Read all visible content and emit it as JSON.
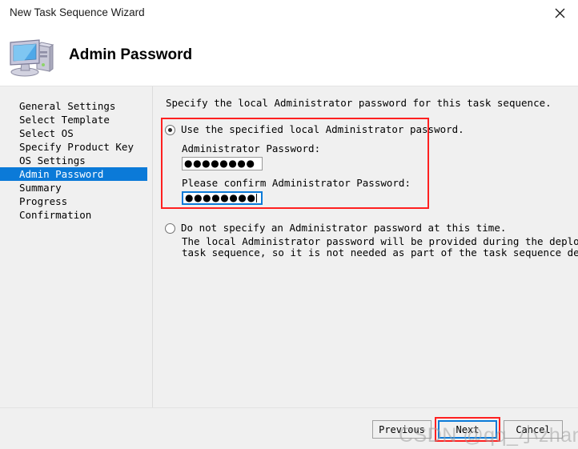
{
  "window": {
    "title": "New Task Sequence Wizard",
    "close_icon": "close-icon"
  },
  "header": {
    "title": "Admin Password",
    "icon": "computer-icon"
  },
  "sidebar": {
    "items": [
      {
        "label": "General Settings",
        "selected": false
      },
      {
        "label": "Select Template",
        "selected": false
      },
      {
        "label": "Select OS",
        "selected": false
      },
      {
        "label": "Specify Product Key",
        "selected": false
      },
      {
        "label": "OS Settings",
        "selected": false
      },
      {
        "label": "Admin Password",
        "selected": true
      },
      {
        "label": "Summary",
        "selected": false
      },
      {
        "label": "Progress",
        "selected": false
      },
      {
        "label": "Confirmation",
        "selected": false
      }
    ]
  },
  "main": {
    "intro": "Specify the local Administrator password for this task sequence.",
    "option_use_specified": {
      "label": "Use the specified local Administrator password.",
      "selected": true,
      "password_label": "Administrator Password:",
      "password_value": "●●●●●●●●",
      "confirm_label": "Please confirm Administrator Password:",
      "confirm_value": "●●●●●●●●"
    },
    "option_do_not_specify": {
      "label": "Do not specify an Administrator password at this time.",
      "selected": false,
      "description_line1": "The local Administrator password will be provided during the deployment of this",
      "description_line2": "task sequence, so it is not needed as part of the task sequence definition."
    }
  },
  "footer": {
    "previous_label": "Previous",
    "next_label": "Next",
    "cancel_label": "Cancel"
  },
  "watermark": {
    "text": "CSDN @qq_小zhang"
  },
  "colors": {
    "accent_blue": "#0b7ad8",
    "annotation_red": "#ff2020",
    "window_background": "#f0f0f0",
    "banner_background": "#ffffff"
  }
}
